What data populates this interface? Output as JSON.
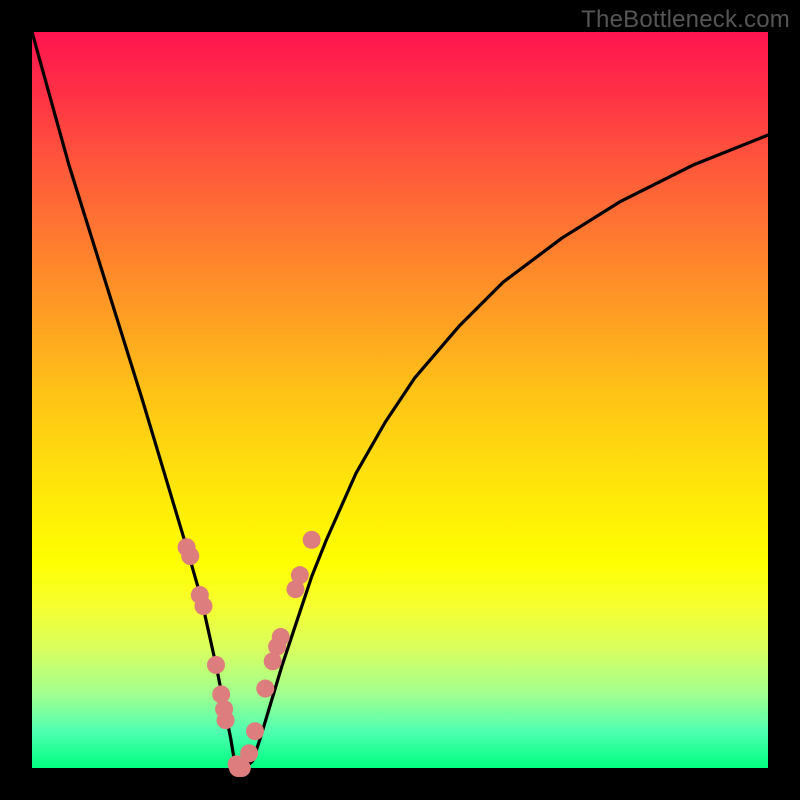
{
  "watermark": "TheBottleneck.com",
  "chart_data": {
    "type": "line",
    "title": "",
    "xlabel": "",
    "ylabel": "",
    "xlim": [
      0,
      1
    ],
    "ylim": [
      0,
      1
    ],
    "series": [
      {
        "name": "bottleneck-curve",
        "x": [
          0.0,
          0.05,
          0.1,
          0.15,
          0.18,
          0.21,
          0.23,
          0.25,
          0.26,
          0.27,
          0.275,
          0.28,
          0.29,
          0.3,
          0.31,
          0.325,
          0.34,
          0.36,
          0.38,
          0.4,
          0.44,
          0.48,
          0.52,
          0.58,
          0.64,
          0.72,
          0.8,
          0.9,
          1.0
        ],
        "y": [
          1.0,
          0.82,
          0.66,
          0.5,
          0.4,
          0.3,
          0.23,
          0.14,
          0.09,
          0.04,
          0.01,
          0.0,
          0.0,
          0.01,
          0.04,
          0.09,
          0.14,
          0.2,
          0.26,
          0.31,
          0.4,
          0.47,
          0.53,
          0.6,
          0.66,
          0.72,
          0.77,
          0.82,
          0.86
        ]
      }
    ],
    "markers": {
      "name": "highlight-dots",
      "color": "#dd7d7d",
      "radius_px": 9,
      "x": [
        0.21,
        0.215,
        0.228,
        0.233,
        0.25,
        0.257,
        0.261,
        0.263,
        0.278,
        0.28,
        0.285,
        0.295,
        0.303,
        0.317,
        0.327,
        0.333,
        0.338,
        0.358,
        0.364,
        0.38
      ],
      "y": [
        0.3,
        0.288,
        0.235,
        0.22,
        0.14,
        0.1,
        0.08,
        0.065,
        0.005,
        0.0,
        0.0,
        0.02,
        0.05,
        0.108,
        0.145,
        0.165,
        0.178,
        0.243,
        0.262,
        0.31
      ]
    }
  }
}
